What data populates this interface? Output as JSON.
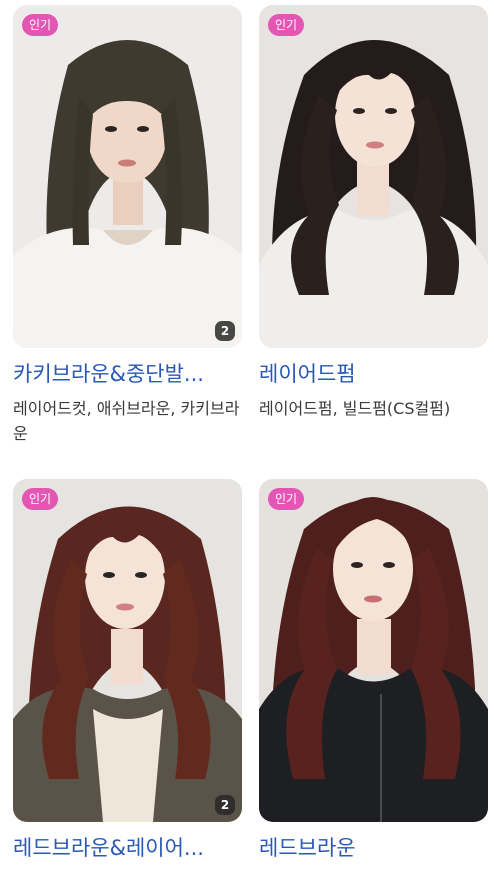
{
  "cards": [
    {
      "badge": "인기",
      "count": "2",
      "title": "카키브라운&중단발...",
      "desc": "레이어드컷, 애쉬브라운, 카키브라운"
    },
    {
      "badge": "인기",
      "title": "레이어드펌",
      "desc": "레이어드펌, 빌드펌(CS컬펌)"
    },
    {
      "badge": "인기",
      "count": "2",
      "title": "레드브라운&레이어..."
    },
    {
      "badge": "인기",
      "title": "레드브라운"
    }
  ],
  "colors": {
    "badge": "#e456b4",
    "title_link": "#2a58b5"
  }
}
